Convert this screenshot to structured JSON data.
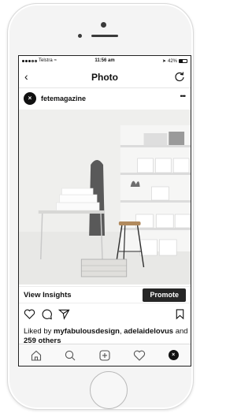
{
  "status_bar": {
    "carrier": "Telstra",
    "time": "11:56 am",
    "battery": "42%"
  },
  "nav": {
    "title": "Photo"
  },
  "post": {
    "username": "fetemagazine",
    "avatar_glyph": "×"
  },
  "insights": {
    "view_label": "View Insights",
    "promote_label": "Promote"
  },
  "likes": {
    "prefix": "Liked by ",
    "user1": "myfabulousdesign",
    "separator": ",",
    "user2": "adelaidelovus",
    "conj": " and ",
    "count": "259 others"
  },
  "icons": {
    "back": "chevron-left-icon",
    "refresh": "refresh-icon",
    "more": "more-icon",
    "like": "heart-icon",
    "comment": "comment-icon",
    "share": "send-icon",
    "bookmark": "bookmark-icon",
    "home": "home-icon",
    "search": "search-icon",
    "add": "add-post-icon",
    "activity": "heart-icon",
    "profile": "profile-icon"
  },
  "colors": {
    "promote_bg": "#262626",
    "text": "#111111"
  }
}
